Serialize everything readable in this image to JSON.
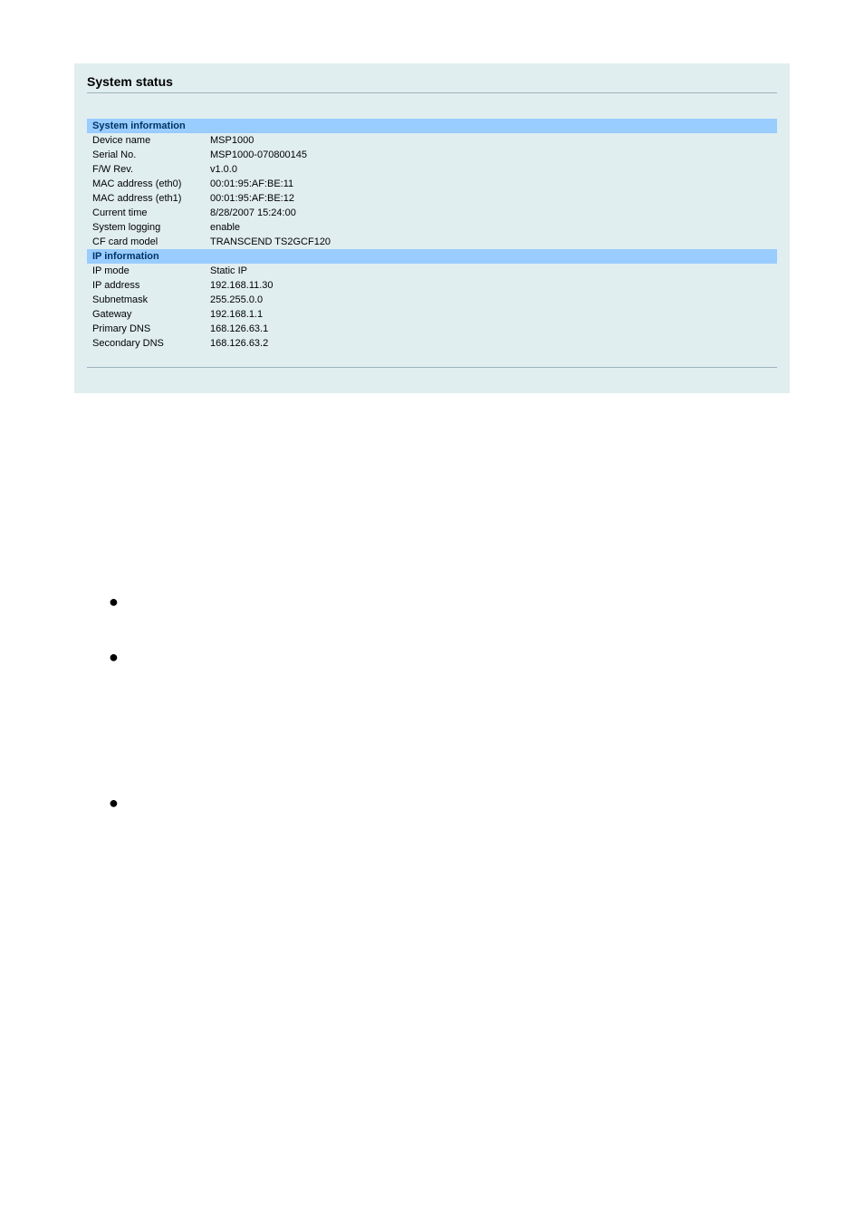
{
  "panel": {
    "title": "System status"
  },
  "sys_info": {
    "header": "System information",
    "rows": {
      "device_name": {
        "label": "Device name",
        "value": "MSP1000"
      },
      "serial_no": {
        "label": "Serial No.",
        "value": "MSP1000-070800145"
      },
      "fw_rev": {
        "label": "F/W Rev.",
        "value": "v1.0.0"
      },
      "mac_eth0": {
        "label": "MAC address (eth0)",
        "value": "00:01:95:AF:BE:11"
      },
      "mac_eth1": {
        "label": "MAC address (eth1)",
        "value": "00:01:95:AF:BE:12"
      },
      "current_time": {
        "label": "Current time",
        "value": "8/28/2007 15:24:00"
      },
      "sys_logging": {
        "label": "System logging",
        "value": "enable"
      },
      "cf_card": {
        "label": "CF card model",
        "value": "TRANSCEND TS2GCF120"
      }
    }
  },
  "ip_info": {
    "header": "IP information",
    "rows": {
      "ip_mode": {
        "label": "IP mode",
        "value": "Static IP"
      },
      "ip_address": {
        "label": "IP address",
        "value": "192.168.11.30"
      },
      "subnetmask": {
        "label": "Subnetmask",
        "value": "255.255.0.0"
      },
      "gateway": {
        "label": "Gateway",
        "value": "192.168.1.1"
      },
      "primary_dns": {
        "label": "Primary DNS",
        "value": "168.126.63.1"
      },
      "secondary_dns": {
        "label": "Secondary DNS",
        "value": "168.126.63.2"
      }
    }
  },
  "bullet": "●"
}
